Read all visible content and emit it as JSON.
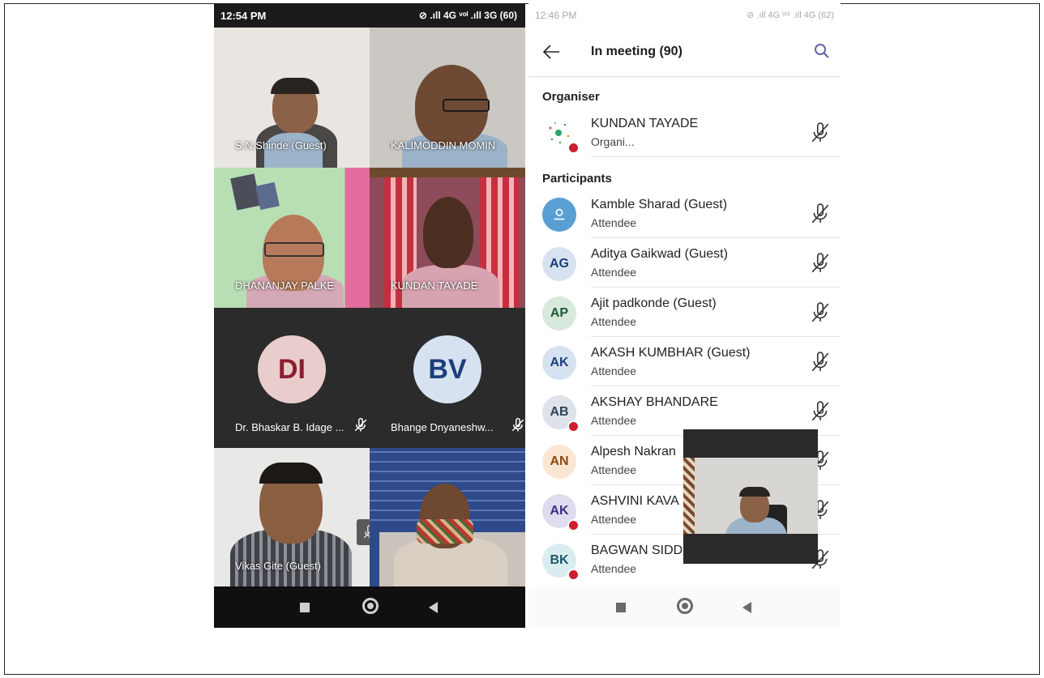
{
  "left_phone": {
    "status": {
      "time": "12:54 PM",
      "icons": "⊘ .ıll 4G ᵛᵒˡ .ıll 3G (60)"
    },
    "tiles": [
      {
        "label": "S.N.Shinde (Guest)"
      },
      {
        "label": "KALIMODDIN MOMIN"
      },
      {
        "label": "DHANANJAY PALKE"
      },
      {
        "label": "KUNDAN TAYADE"
      },
      {
        "label": "Dr. Bhaskar B. Idage ...",
        "initials": "DI"
      },
      {
        "label": "Bhange Dnyaneshw...",
        "initials": "BV"
      },
      {
        "label": "Vikas Gite (Guest)"
      },
      {
        "label": ""
      }
    ]
  },
  "right_phone": {
    "status": {
      "time": "12:46 PM",
      "icons": "⊘ .ıll 4G ᵛᵒˡ .ıll 4G (62)"
    },
    "header": {
      "title": "In meeting (90)"
    },
    "organiser_heading": "Organiser",
    "participants_heading": "Participants",
    "organiser": {
      "name": "KUNDAN TAYADE",
      "role": "Organi..."
    },
    "participants": [
      {
        "name": "Kamble Sharad (Guest)",
        "role": "Attendee",
        "initials": ""
      },
      {
        "name": "Aditya Gaikwad (Guest)",
        "role": "Attendee",
        "initials": "AG"
      },
      {
        "name": "Ajit padkonde (Guest)",
        "role": "Attendee",
        "initials": "AP"
      },
      {
        "name": "AKASH KUMBHAR (Guest)",
        "role": "Attendee",
        "initials": "AK"
      },
      {
        "name": "AKSHAY BHANDARE",
        "role": "Attendee",
        "initials": "AB"
      },
      {
        "name": "Alpesh Nakran",
        "role": "Attendee",
        "initials": "AN"
      },
      {
        "name": "ASHVINI KAVA",
        "role": "Attendee",
        "initials": "AK"
      },
      {
        "name": "BAGWAN SIDD",
        "role": "Attendee",
        "initials": "BK"
      }
    ]
  },
  "colors": {
    "accent": "#6264a7",
    "presence_red": "#cc1f2f",
    "avatar_blue": "#d6e2f0",
    "avatar_green": "#d7e8dc",
    "avatar_orange": "#fbe6d4",
    "avatar_purple": "#e0dcef",
    "avatar_pink": "#e9cdcd",
    "avatar_guest": "#5a9fd4"
  }
}
